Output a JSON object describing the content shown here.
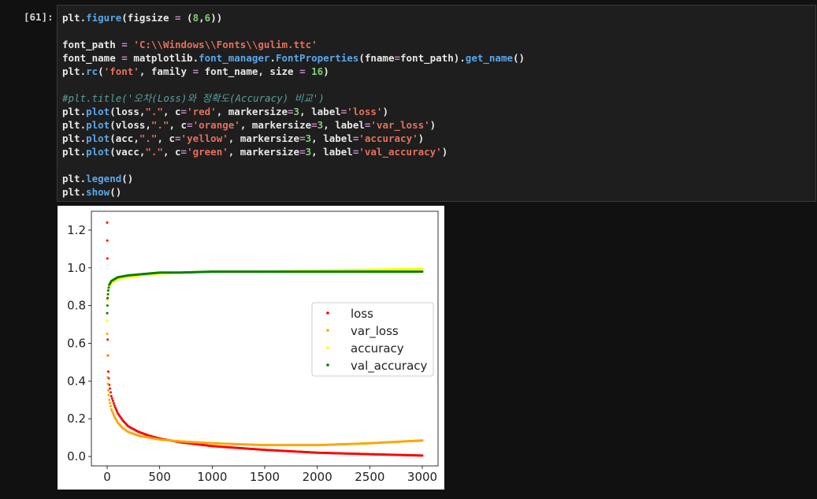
{
  "cell": {
    "prompt": "[61]:",
    "lines": [
      [
        [
          "kw",
          "plt."
        ],
        [
          "fn",
          "figure"
        ],
        [
          "kw",
          "(figsize "
        ],
        [
          "op",
          "="
        ],
        [
          "kw",
          " ("
        ],
        [
          "num",
          "8"
        ],
        [
          "kw",
          ","
        ],
        [
          "num",
          "6"
        ],
        [
          "kw",
          "))"
        ]
      ],
      [],
      [
        [
          "kw",
          "font_path "
        ],
        [
          "op",
          "="
        ],
        [
          "kw",
          " "
        ],
        [
          "str",
          "'C:\\\\Windows\\\\Fonts\\\\gulim.ttc'"
        ]
      ],
      [
        [
          "kw",
          "font_name "
        ],
        [
          "op",
          "="
        ],
        [
          "kw",
          " matplotlib."
        ],
        [
          "fn",
          "font_manager"
        ],
        [
          "kw",
          "."
        ],
        [
          "fn",
          "FontProperties"
        ],
        [
          "kw",
          "(fname"
        ],
        [
          "op",
          "="
        ],
        [
          "kw",
          "font_path)."
        ],
        [
          "fn",
          "get_name"
        ],
        [
          "kw",
          "()"
        ]
      ],
      [
        [
          "kw",
          "plt."
        ],
        [
          "fn",
          "rc"
        ],
        [
          "kw",
          "("
        ],
        [
          "str",
          "'font'"
        ],
        [
          "kw",
          ", family "
        ],
        [
          "op",
          "="
        ],
        [
          "kw",
          " font_name, size "
        ],
        [
          "op",
          "="
        ],
        [
          "kw",
          " "
        ],
        [
          "num",
          "16"
        ],
        [
          "kw",
          ")"
        ]
      ],
      [],
      [
        [
          "cmt",
          "#plt.title('오차(Loss)와 정확도(Accuracy) 비교')"
        ]
      ],
      [
        [
          "kw",
          "plt."
        ],
        [
          "fn",
          "plot"
        ],
        [
          "kw",
          "(loss,"
        ],
        [
          "str",
          "\".\""
        ],
        [
          "kw",
          ", c"
        ],
        [
          "op",
          "="
        ],
        [
          "str",
          "'red'"
        ],
        [
          "kw",
          ", markersize"
        ],
        [
          "op",
          "="
        ],
        [
          "num",
          "3"
        ],
        [
          "kw",
          ", label"
        ],
        [
          "op",
          "="
        ],
        [
          "str",
          "'loss'"
        ],
        [
          "kw",
          ")"
        ]
      ],
      [
        [
          "kw",
          "plt."
        ],
        [
          "fn",
          "plot"
        ],
        [
          "kw",
          "(vloss,"
        ],
        [
          "str",
          "\".\""
        ],
        [
          "kw",
          ", c"
        ],
        [
          "op",
          "="
        ],
        [
          "str",
          "'orange'"
        ],
        [
          "kw",
          ", markersize"
        ],
        [
          "op",
          "="
        ],
        [
          "num",
          "3"
        ],
        [
          "kw",
          ", label"
        ],
        [
          "op",
          "="
        ],
        [
          "str",
          "'var_loss'"
        ],
        [
          "kw",
          ")"
        ]
      ],
      [
        [
          "kw",
          "plt."
        ],
        [
          "fn",
          "plot"
        ],
        [
          "kw",
          "(acc,"
        ],
        [
          "str",
          "\".\""
        ],
        [
          "kw",
          ", c"
        ],
        [
          "op",
          "="
        ],
        [
          "str",
          "'yellow'"
        ],
        [
          "kw",
          ", markersize"
        ],
        [
          "op",
          "="
        ],
        [
          "num",
          "3"
        ],
        [
          "kw",
          ", label"
        ],
        [
          "op",
          "="
        ],
        [
          "str",
          "'accuracy'"
        ],
        [
          "kw",
          ")"
        ]
      ],
      [
        [
          "kw",
          "plt."
        ],
        [
          "fn",
          "plot"
        ],
        [
          "kw",
          "(vacc,"
        ],
        [
          "str",
          "\".\""
        ],
        [
          "kw",
          ", c"
        ],
        [
          "op",
          "="
        ],
        [
          "str",
          "'green'"
        ],
        [
          "kw",
          ", markersize"
        ],
        [
          "op",
          "="
        ],
        [
          "num",
          "3"
        ],
        [
          "kw",
          ", label"
        ],
        [
          "op",
          "="
        ],
        [
          "str",
          "'val_accuracy'"
        ],
        [
          "kw",
          ")"
        ]
      ],
      [],
      [
        [
          "kw",
          "plt."
        ],
        [
          "fn",
          "legend"
        ],
        [
          "kw",
          "()"
        ]
      ],
      [
        [
          "kw",
          "plt."
        ],
        [
          "fn",
          "show"
        ],
        [
          "kw",
          "()"
        ]
      ]
    ]
  },
  "chart_data": {
    "type": "scatter",
    "title": "",
    "xlabel": "",
    "ylabel": "",
    "xlim": [
      -150,
      3150
    ],
    "ylim": [
      -0.05,
      1.3
    ],
    "xticks": [
      0,
      500,
      1000,
      1500,
      2000,
      2500,
      3000
    ],
    "yticks": [
      0.0,
      0.2,
      0.4,
      0.6,
      0.8,
      1.0,
      1.2
    ],
    "legend_position": "center-right",
    "grid": false,
    "series": [
      {
        "name": "loss",
        "color": "#ff0000",
        "x": [
          0,
          2,
          5,
          10,
          20,
          40,
          70,
          100,
          150,
          200,
          300,
          400,
          500,
          700,
          1000,
          1500,
          2000,
          2500,
          3000
        ],
        "y": [
          1.24,
          1.05,
          0.62,
          0.45,
          0.38,
          0.32,
          0.27,
          0.23,
          0.19,
          0.16,
          0.13,
          0.11,
          0.095,
          0.075,
          0.055,
          0.035,
          0.02,
          0.012,
          0.005
        ]
      },
      {
        "name": "var_loss",
        "color": "#ffa500",
        "x": [
          0,
          5,
          10,
          20,
          40,
          70,
          100,
          150,
          200,
          300,
          400,
          500,
          700,
          1000,
          1500,
          2000,
          2500,
          3000
        ],
        "y": [
          0.65,
          0.42,
          0.35,
          0.3,
          0.25,
          0.21,
          0.18,
          0.15,
          0.13,
          0.11,
          0.1,
          0.09,
          0.08,
          0.07,
          0.06,
          0.06,
          0.07,
          0.085
        ]
      },
      {
        "name": "accuracy",
        "color": "#ffff00",
        "x": [
          0,
          5,
          10,
          20,
          40,
          70,
          100,
          150,
          200,
          300,
          500,
          700,
          1000,
          1500,
          2000,
          2500,
          3000
        ],
        "y": [
          0.72,
          0.8,
          0.86,
          0.9,
          0.92,
          0.93,
          0.94,
          0.95,
          0.95,
          0.96,
          0.97,
          0.975,
          0.98,
          0.98,
          0.985,
          0.99,
          0.995
        ]
      },
      {
        "name": "val_accuracy",
        "color": "#008000",
        "x": [
          0,
          5,
          10,
          20,
          40,
          70,
          100,
          150,
          200,
          300,
          500,
          700,
          1000,
          1500,
          2000,
          2500,
          3000
        ],
        "y": [
          0.76,
          0.84,
          0.88,
          0.91,
          0.93,
          0.94,
          0.95,
          0.955,
          0.96,
          0.965,
          0.975,
          0.975,
          0.98,
          0.98,
          0.98,
          0.98,
          0.98
        ]
      }
    ]
  }
}
